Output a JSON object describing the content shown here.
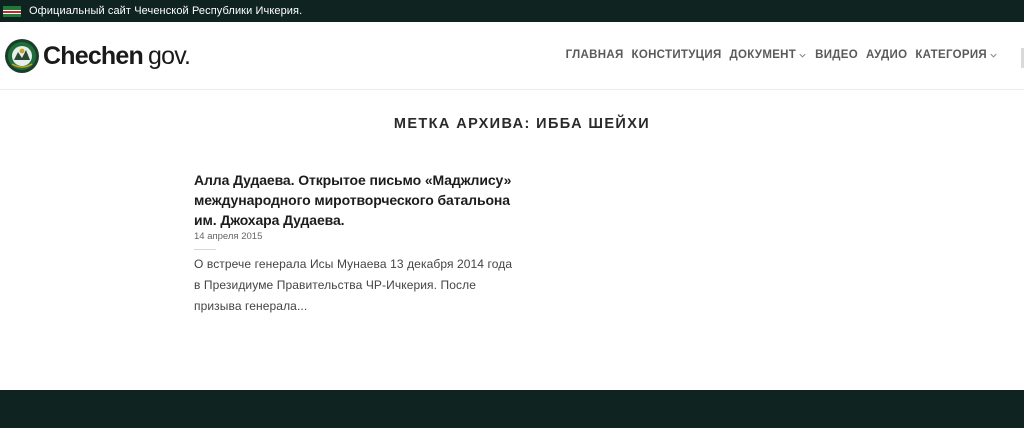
{
  "topbar": {
    "text": "Официальный сайт Чеченской Республики Ичкерия.",
    "flag_colors": [
      "#1f7a3a",
      "#ffffff",
      "#c9252c",
      "#ffffff",
      "#1f7a3a"
    ]
  },
  "logo": {
    "brand": "Chechen",
    "suffix": "gov."
  },
  "nav": {
    "items": [
      {
        "label": "ГЛАВНАЯ",
        "dropdown": false
      },
      {
        "label": "КОНСТИТУЦИЯ",
        "dropdown": false
      },
      {
        "label": "ДОКУМЕНТ",
        "dropdown": true
      },
      {
        "label": "ВИДЕО",
        "dropdown": false
      },
      {
        "label": "АУДИО",
        "dropdown": false
      },
      {
        "label": "КАТЕГОРИЯ",
        "dropdown": true
      }
    ]
  },
  "archive": {
    "title": "МЕТКА АРХИВА: ИББА ШЕЙХИ"
  },
  "post": {
    "title": "Алла Дудаева. Открытое письмо «Маджлису» международного миротворческого батальона им. Джохара Дудаева.",
    "date": "14 апреля 2015",
    "excerpt": "О встрече генерала Исы Мунаева 13 декабря 2014 года в Президиуме Правительства ЧР-Ичкерия. После призыва генерала..."
  },
  "colors": {
    "dark_bar": "#0f2420",
    "emblem_green": "#1f6e3a",
    "text_dark": "#1c1c1c"
  }
}
